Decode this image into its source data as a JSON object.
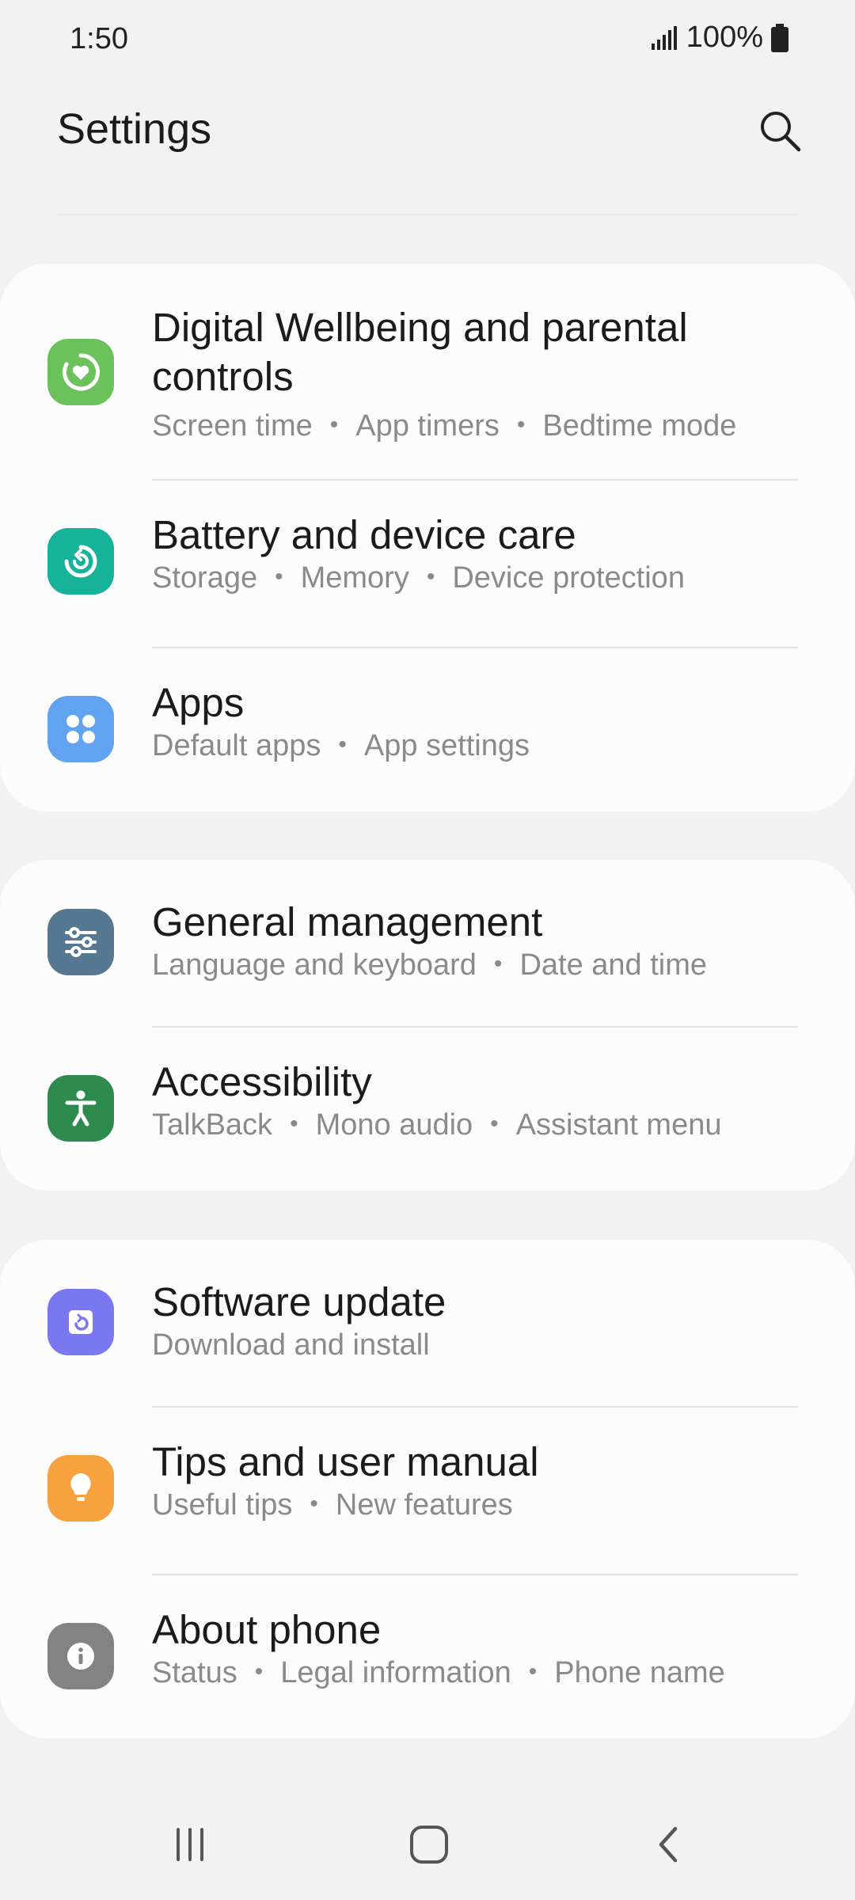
{
  "status_bar": {
    "time": "1:50",
    "battery": "100%"
  },
  "header": {
    "title": "Settings"
  },
  "groups": [
    [
      {
        "title": "Digital Wellbeing and parental controls",
        "subs": [
          "Screen time",
          "App timers",
          "Bedtime mode"
        ],
        "icon": "digital-wellbeing-icon",
        "color": "#6cc25a"
      },
      {
        "title": "Battery and device care",
        "subs": [
          "Storage",
          "Memory",
          "Device protection"
        ],
        "icon": "device-care-icon",
        "color": "#16b39a"
      },
      {
        "title": "Apps",
        "subs": [
          "Default apps",
          "App settings"
        ],
        "icon": "apps-icon",
        "color": "#5fa3f2"
      }
    ],
    [
      {
        "title": "General management",
        "subs": [
          "Language and keyboard",
          "Date and time"
        ],
        "icon": "general-management-icon",
        "color": "#577891"
      },
      {
        "title": "Accessibility",
        "subs": [
          "TalkBack",
          "Mono audio",
          "Assistant menu"
        ],
        "icon": "accessibility-icon",
        "color": "#2e8b4e"
      }
    ],
    [
      {
        "title": "Software update",
        "subs": [
          "Download and install"
        ],
        "icon": "software-update-icon",
        "color": "#7a78f0"
      },
      {
        "title": "Tips and user manual",
        "subs": [
          "Useful tips",
          "New features"
        ],
        "icon": "tips-bulb-icon",
        "color": "#f7a23e"
      },
      {
        "title": "About phone",
        "subs": [
          "Status",
          "Legal information",
          "Phone name"
        ],
        "icon": "info-icon",
        "color": "#838383"
      }
    ]
  ]
}
